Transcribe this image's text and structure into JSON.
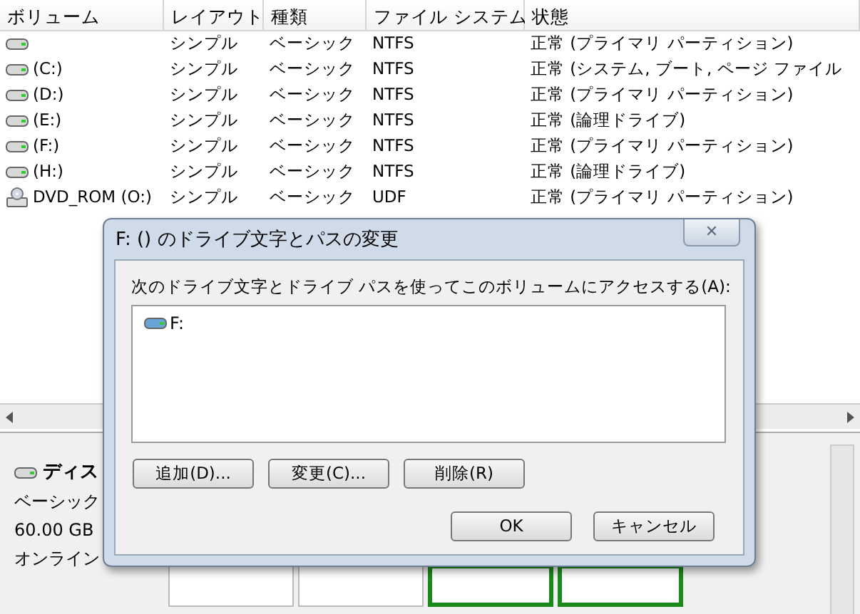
{
  "volume_table": {
    "columns": [
      "ボリューム",
      "レイアウト",
      "種類",
      "ファイル システム",
      "状態"
    ],
    "rows": [
      {
        "kind": "disk",
        "cells": [
          "",
          "シンプル",
          "ベーシック",
          "NTFS",
          "正常 (プライマリ パーティション)"
        ]
      },
      {
        "kind": "disk",
        "cells": [
          "(C:)",
          "シンプル",
          "ベーシック",
          "NTFS",
          "正常 (システム, ブート, ページ ファイル"
        ]
      },
      {
        "kind": "disk",
        "cells": [
          "(D:)",
          "シンプル",
          "ベーシック",
          "NTFS",
          "正常 (プライマリ パーティション)"
        ]
      },
      {
        "kind": "disk",
        "cells": [
          "(E:)",
          "シンプル",
          "ベーシック",
          "NTFS",
          "正常 (論理ドライブ)"
        ]
      },
      {
        "kind": "disk",
        "cells": [
          "(F:)",
          "シンプル",
          "ベーシック",
          "NTFS",
          "正常 (プライマリ パーティション)"
        ]
      },
      {
        "kind": "disk",
        "cells": [
          "(H:)",
          "シンプル",
          "ベーシック",
          "NTFS",
          "正常 (論理ドライブ)"
        ]
      },
      {
        "kind": "dvd",
        "cells": [
          "DVD_ROM (O:)",
          "シンプル",
          "ベーシック",
          "UDF",
          "正常 (プライマリ パーティション)"
        ]
      }
    ]
  },
  "disk_panel": {
    "name": "ディス",
    "type": "ベーシック",
    "size": "60.00 GB",
    "status": "オンライン",
    "partitions": [
      {
        "selected": false
      },
      {
        "selected": false
      },
      {
        "selected": true
      },
      {
        "selected": true
      }
    ]
  },
  "dialog": {
    "title": "F: () のドライブ文字とパスの変更",
    "close": "✕",
    "label": "次のドライブ文字とドライブ パスを使ってこのボリュームにアクセスする(A):",
    "paths": [
      "F:"
    ],
    "buttons": [
      "追加(D)...",
      "変更(C)...",
      "削除(R)"
    ],
    "footer_buttons": [
      "OK",
      "キャンセル"
    ]
  }
}
